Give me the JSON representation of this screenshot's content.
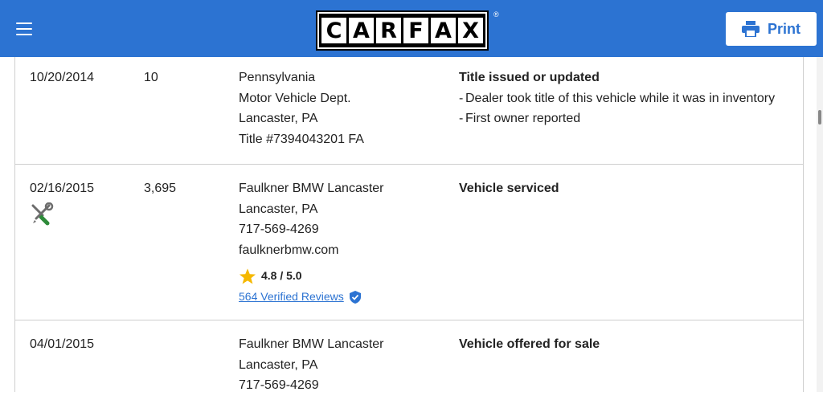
{
  "header": {
    "brand_letters": [
      "C",
      "A",
      "R",
      "F",
      "A",
      "X"
    ],
    "brand_mark": "®",
    "print_label": "Print",
    "menu_icon": "hamburger-menu-icon",
    "print_icon": "printer-icon"
  },
  "colors": {
    "header_bg": "#2c73d2",
    "link": "#2c73d2",
    "star": "#f5b800",
    "verified": "#2c73d2"
  },
  "records": [
    {
      "date": "10/20/2014",
      "odometer": "10",
      "source": [
        "Pennsylvania",
        "Motor Vehicle Dept.",
        "Lancaster, PA",
        "Title #7394043201 FA"
      ],
      "event_title": "Title issued or updated",
      "details": [
        "Dealer took title of this vehicle while it was in inventory",
        "First owner reported"
      ]
    },
    {
      "date": "02/16/2015",
      "odometer": "3,695",
      "icon": "wrench-screwdriver-icon",
      "source": [
        "Faulkner BMW Lancaster",
        "Lancaster, PA",
        "717-569-4269",
        "faulknerbmw.com"
      ],
      "rating": "4.8 / 5.0",
      "reviews_link": "564 Verified Reviews",
      "event_title": "Vehicle serviced"
    },
    {
      "date": "04/01/2015",
      "odometer": "",
      "source": [
        "Faulkner BMW Lancaster",
        "Lancaster, PA",
        "717-569-4269"
      ],
      "event_title": "Vehicle offered for sale"
    }
  ]
}
